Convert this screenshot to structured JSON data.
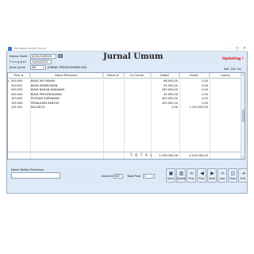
{
  "window": {
    "title": "Transaksi Jurnal Umum",
    "controls": {
      "minimize": "–",
      "maximize": "□",
      "close": "✕"
    }
  },
  "header": {
    "title": "Jurnal Umum",
    "status": "Updating !"
  },
  "form": {
    "nomor_bukti_label": "Nomor Bukti",
    "nomor_bukti_value": "JU/10/10/0000",
    "tanggal_label": "T a n g g a l",
    "tanggal_value": "14/01/2010",
    "jenis_jurnal_label": "Jenis Jurnal",
    "jenis_jurnal_value": "KM",
    "jenis_jurnal_desc": "JURNAL PENGELUARAN KAS"
  },
  "grid_actions": {
    "add": "Add",
    "del": "Del",
    "ins": "Ins"
  },
  "grid": {
    "columns": [
      "Perk #",
      "Nama Perkiraan",
      "Detail #",
      "Co-Center",
      "Debet",
      "Kredit",
      "Uraian"
    ],
    "rows": [
      {
        "perk": "500.500",
        "nama": "BIAYA AIR MINUM",
        "detail": "",
        "cc": "",
        "debet": "68.000,00",
        "kredit": "0,00",
        "uraian": ""
      },
      {
        "perk": "500.501",
        "nama": "BIAYA KEBERSIHAN",
        "detail": "",
        "cc": "",
        "debet": "35.000,00",
        "kredit": "0,00",
        "uraian": ""
      },
      {
        "perk": "500.503",
        "nama": "BIAYA BAHAN MAKANAN",
        "detail": "",
        "cc": "",
        "debet": "299.000,00",
        "kredit": "0,00",
        "uraian": ""
      },
      {
        "perk": "500.400",
        "nama": "BIAYA PERLENGKAPAN",
        "detail": "",
        "cc": "",
        "debet": "42.000,00",
        "kredit": "0,00",
        "uraian": ""
      },
      {
        "perk": "103.002",
        "nama": "PIUTANG KARYAWAN",
        "detail": "",
        "cc": "",
        "debet": "400.000,00",
        "kredit": "0,00",
        "uraian": ""
      },
      {
        "perk": "100.300",
        "nama": "PERALATAN KANTOR",
        "detail": "",
        "cc": "",
        "debet": "435.000,00",
        "kredit": "0,00",
        "uraian": ""
      },
      {
        "perk": "101.001",
        "nama": "KAS KECIL",
        "detail": "",
        "cc": "",
        "debet": "0,00",
        "kredit": "1.229.000,00",
        "uraian": ""
      }
    ],
    "total_label": "T O T A L",
    "total_debet": "1.229.000,00",
    "total_kredit": "1.229.000,00"
  },
  "footer": {
    "nama_label": "Nama Daftar Perkiraan",
    "saved_by_label": "Saved by",
    "saved_by_value": "887",
    "total_posts_label": "Total Post",
    "total_posts_value": "0"
  },
  "toolbar": {
    "save": "Save",
    "delete": "Delete",
    "first": "First",
    "prev": "Prev",
    "next": "Next",
    "last": "Last",
    "clear": "Clear",
    "exit": "Exit"
  },
  "icons": {
    "search": "search-icon",
    "save": "disk-icon",
    "delete": "trash-icon",
    "first": "binoculars-icon",
    "prev": "back-arrow-icon",
    "next": "forward-arrow-icon",
    "last": "binoculars-icon",
    "clear": "eraser-icon",
    "exit": "door-icon"
  }
}
